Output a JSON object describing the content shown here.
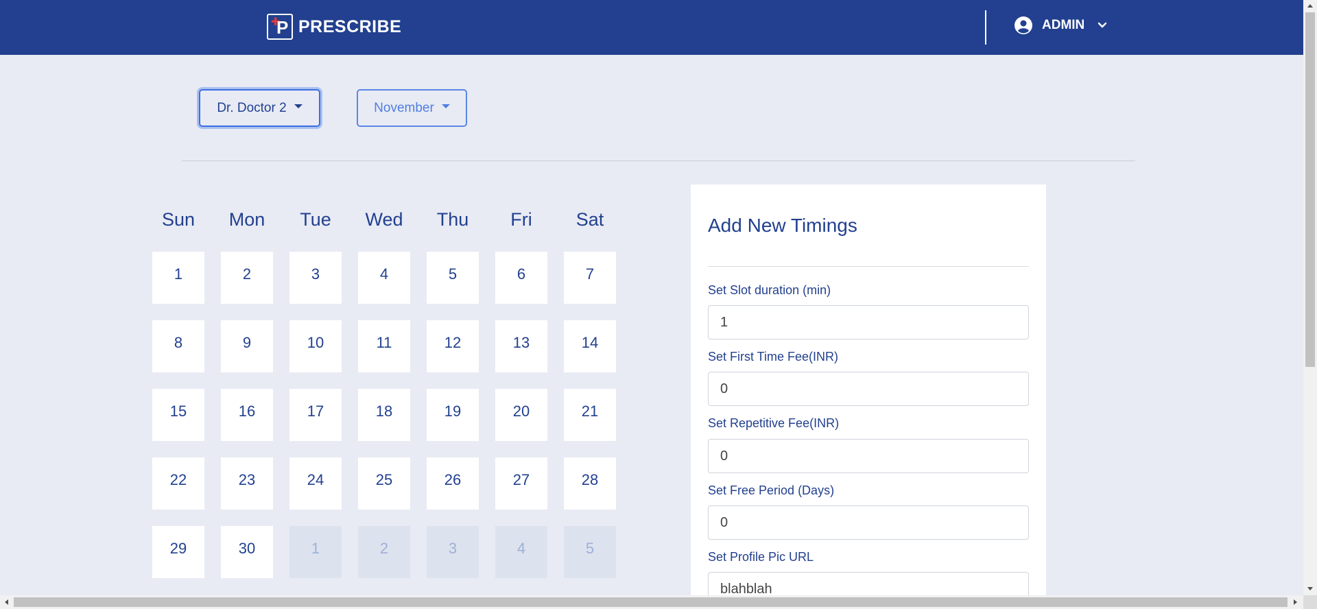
{
  "header": {
    "brand_name": "PRESCRIBE",
    "user_name": "ADMIN",
    "bg_color": "#22408f"
  },
  "filters": {
    "doctor": "Dr. Doctor 2",
    "month": "November"
  },
  "calendar": {
    "day_names": [
      "Sun",
      "Mon",
      "Tue",
      "Wed",
      "Thu",
      "Fri",
      "Sat"
    ],
    "weeks": [
      [
        {
          "d": "1"
        },
        {
          "d": "2"
        },
        {
          "d": "3"
        },
        {
          "d": "4"
        },
        {
          "d": "5"
        },
        {
          "d": "6"
        },
        {
          "d": "7"
        }
      ],
      [
        {
          "d": "8"
        },
        {
          "d": "9"
        },
        {
          "d": "10"
        },
        {
          "d": "11"
        },
        {
          "d": "12"
        },
        {
          "d": "13"
        },
        {
          "d": "14"
        }
      ],
      [
        {
          "d": "15"
        },
        {
          "d": "16"
        },
        {
          "d": "17"
        },
        {
          "d": "18"
        },
        {
          "d": "19"
        },
        {
          "d": "20"
        },
        {
          "d": "21"
        }
      ],
      [
        {
          "d": "22"
        },
        {
          "d": "23"
        },
        {
          "d": "24"
        },
        {
          "d": "25"
        },
        {
          "d": "26"
        },
        {
          "d": "27"
        },
        {
          "d": "28"
        }
      ],
      [
        {
          "d": "29"
        },
        {
          "d": "30"
        },
        {
          "d": "1",
          "muted": true
        },
        {
          "d": "2",
          "muted": true
        },
        {
          "d": "3",
          "muted": true
        },
        {
          "d": "4",
          "muted": true
        },
        {
          "d": "5",
          "muted": true
        }
      ]
    ]
  },
  "timings": {
    "title": "Add New Timings",
    "fields": [
      {
        "label": "Set Slot duration (min)",
        "value": "1"
      },
      {
        "label": "Set First Time Fee(INR)",
        "value": "0"
      },
      {
        "label": "Set Repetitive Fee(INR)",
        "value": "0"
      },
      {
        "label": "Set Free Period (Days)",
        "value": "0"
      },
      {
        "label": "Set Profile Pic URL",
        "value": "blahblah"
      }
    ]
  }
}
